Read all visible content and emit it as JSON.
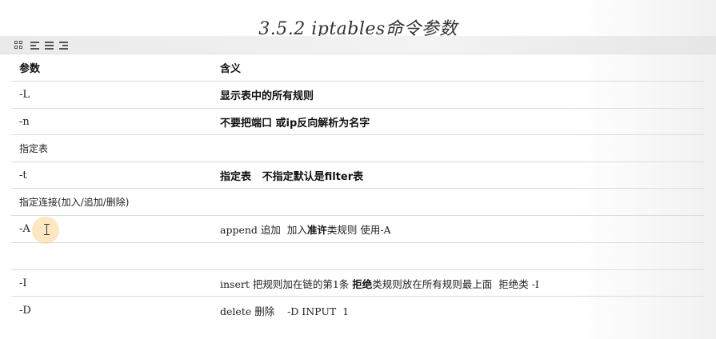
{
  "document": {
    "title": "3.5.2 iptables命令参数"
  },
  "toolbar": {
    "icons": [
      "grid-view-icon",
      "align-left-icon",
      "align-center-icon",
      "align-right-icon"
    ]
  },
  "table": {
    "header": {
      "param": "参数",
      "meaning": "含义"
    },
    "rows": [
      {
        "param": "-L",
        "meaning": "显示表中的所有规则"
      },
      {
        "param": "-n",
        "meaning": "不要把端口 或ip反向解析为名字"
      },
      {
        "param": "指定表",
        "meaning": ""
      },
      {
        "param": "-t",
        "meaning": "指定表   不指定默认是filter表"
      },
      {
        "param": "指定连接(加入/追加/删除)",
        "meaning": ""
      },
      {
        "param": "-A",
        "meaning_parts": [
          "append 追加  加入",
          "准许",
          "类规则 使用-A"
        ]
      },
      {
        "param": "",
        "meaning": ""
      },
      {
        "param": "-I",
        "meaning_parts": [
          "insert 把规则加在链的第1条 ",
          "拒绝",
          "类规则放在所有规则最上面  拒绝类 -I"
        ]
      },
      {
        "param": "-D",
        "meaning": "delete 删除    -D INPUT  1"
      }
    ]
  }
}
